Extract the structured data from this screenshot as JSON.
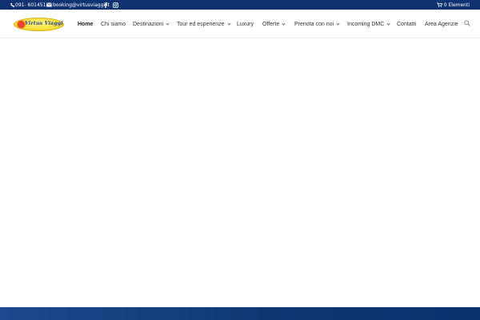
{
  "topbar": {
    "phone": "091- 6014515",
    "email": "booking@virtusviaggi.it",
    "social": [
      "facebook-icon",
      "instagram-icon"
    ],
    "cart": "0 Elementi",
    "background": "#0f3270"
  },
  "header": {
    "logo_text": "Virtus Viaggi",
    "nav": [
      {
        "label": "Home",
        "active": true,
        "dropdown": false
      },
      {
        "label": "Chi siamo",
        "active": false,
        "dropdown": false
      },
      {
        "label": "Destinazioni",
        "active": false,
        "dropdown": true
      },
      {
        "label": "Tour ed esperienze",
        "active": false,
        "dropdown": true
      },
      {
        "label": "Luxury",
        "active": false,
        "dropdown": false
      },
      {
        "label": "Offerte",
        "active": false,
        "dropdown": true
      },
      {
        "label": "Prenota con noi",
        "active": false,
        "dropdown": true
      },
      {
        "label": "Incoming DMC",
        "active": false,
        "dropdown": true
      },
      {
        "label": "Contatti",
        "active": false,
        "dropdown": false
      },
      {
        "label": "Area Agenzie",
        "active": false,
        "dropdown": false
      }
    ],
    "search_icon": "search-icon"
  },
  "colors": {
    "accent": "#0f3270",
    "logo_yellow": "#f7e03b",
    "logo_blue": "#2344a3"
  }
}
